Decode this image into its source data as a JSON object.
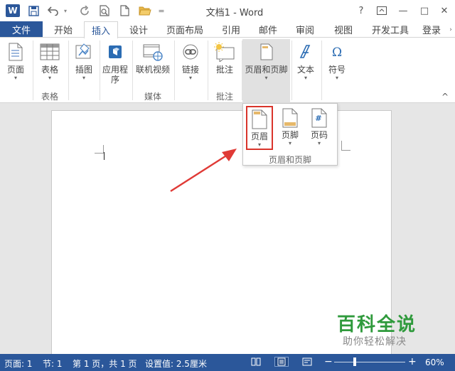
{
  "app": {
    "title": "文档1 - Word",
    "logo_letter": "W"
  },
  "quick_access": {
    "undo_icon": "undo-icon",
    "redo_icon": "redo-icon",
    "customize_glyph": "="
  },
  "window_controls": {
    "help": "?",
    "minimize": "—",
    "maximize": "□",
    "close": "✕"
  },
  "tabs": {
    "file": "文件",
    "items": [
      "开始",
      "插入",
      "设计",
      "页面布局",
      "引用",
      "邮件",
      "审阅",
      "视图",
      "开发工具"
    ],
    "active": "插入",
    "signin": "登录"
  },
  "ribbon": {
    "buttons": {
      "page": "页面",
      "table": "表格",
      "pictures": "插图",
      "apps": "应用程\n序",
      "online_video": "联机视频",
      "link": "链接",
      "comment": "批注",
      "header_footer": "页眉和页脚",
      "text": "文本",
      "symbol": "符号"
    },
    "groups": {
      "tables": "表格",
      "media": "媒体",
      "comments": "批注"
    }
  },
  "dropdown": {
    "items": [
      "页眉",
      "页脚",
      "页码"
    ],
    "selected": "页眉",
    "group_label": "页眉和页脚"
  },
  "watermark": {
    "title": "百科全说",
    "subtitle": "助你轻松解决"
  },
  "status": {
    "page": "页面: 1",
    "section": "节: 1",
    "page_count": "第 1 页，共 1 页",
    "setting": "设置值: 2.5厘米",
    "zoom": "60%",
    "zoom_percent": 60,
    "accent": "#2b579a"
  },
  "colors": {
    "brand": "#2b579a",
    "arrow": "#e03a36",
    "watermark_green": "#2f9a3c"
  }
}
